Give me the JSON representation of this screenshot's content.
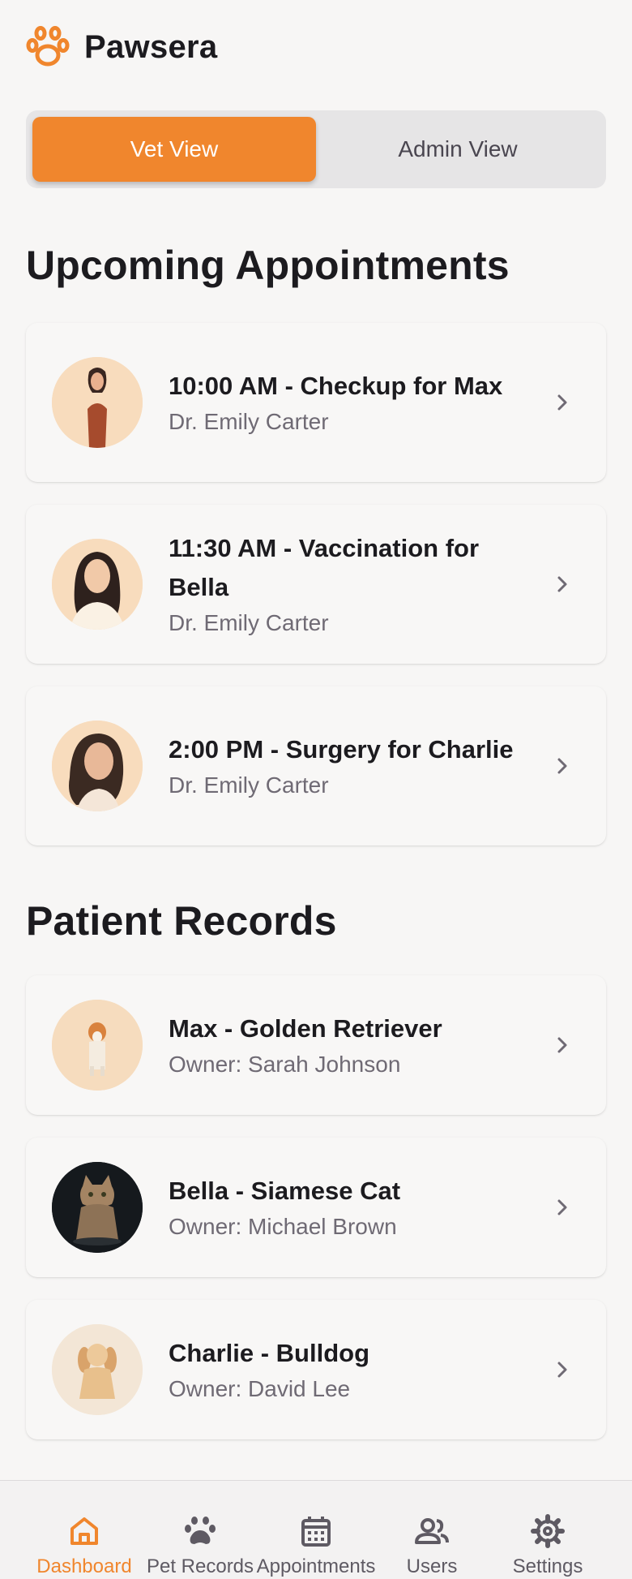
{
  "app": {
    "title": "Pawsera",
    "accent": "#f0862d"
  },
  "view_toggle": {
    "vet_label": "Vet View",
    "admin_label": "Admin View",
    "selected": "Vet View"
  },
  "appointments": {
    "heading": "Upcoming Appointments",
    "items": [
      {
        "title": "10:00 AM - Checkup for Max",
        "doctor": "Dr. Emily Carter"
      },
      {
        "title": "11:30 AM - Vaccination for Bella",
        "doctor": "Dr. Emily Carter"
      },
      {
        "title": "2:00 PM - Surgery for Charlie",
        "doctor": "Dr. Emily Carter"
      }
    ]
  },
  "records": {
    "heading": "Patient Records",
    "items": [
      {
        "title": "Max - Golden Retriever",
        "owner": "Owner: Sarah Johnson"
      },
      {
        "title": "Bella - Siamese Cat",
        "owner": "Owner: Michael Brown"
      },
      {
        "title": "Charlie - Bulldog",
        "owner": "Owner: David Lee"
      }
    ]
  },
  "nav": {
    "items": [
      {
        "label": "Dashboard",
        "icon": "home-icon",
        "active": true
      },
      {
        "label": "Pet Records",
        "icon": "paw-icon"
      },
      {
        "label": "Appointments",
        "icon": "calendar-icon"
      },
      {
        "label": "Users",
        "icon": "users-icon"
      },
      {
        "label": "Settings",
        "icon": "gear-icon"
      }
    ]
  }
}
